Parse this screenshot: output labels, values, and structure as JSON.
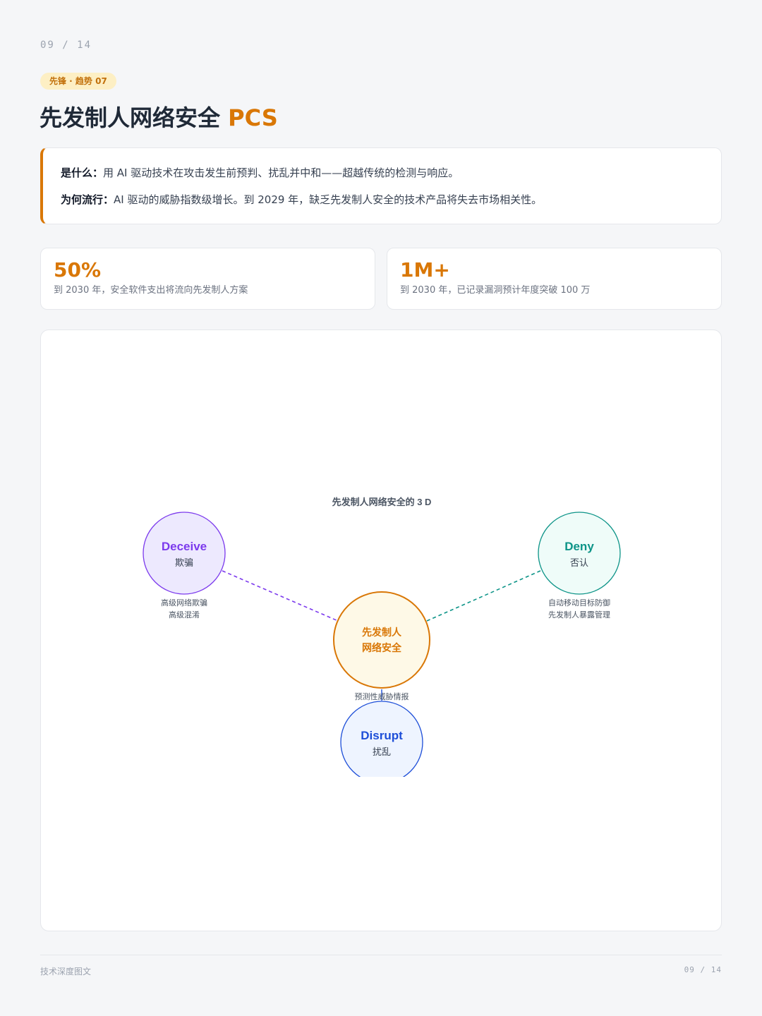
{
  "page": {
    "number": "09 / 14",
    "footer_left": "技术深度图文"
  },
  "header": {
    "tag": "先锋 · 趋势 07",
    "title_main": "先发制人网络安全",
    "title_accent": "PCS"
  },
  "intro": {
    "what_label": "是什么：",
    "what_text": "用 AI 驱动技术在攻击发生前预判、扰乱并中和——超越传统的检测与响应。",
    "why_label": "为何流行：",
    "why_text": "AI 驱动的威胁指数级增长。到 2029 年，缺乏先发制人安全的技术产品将失去市场相关性。"
  },
  "stats": [
    {
      "value": "50%",
      "label": "到 2030 年，安全软件支出将流向先发制人方案"
    },
    {
      "value": "1M+",
      "label": "到 2030 年，已记录漏洞预计年度突破 100 万"
    }
  ],
  "diagram": {
    "title": "先发制人网络安全的 3 D",
    "center": {
      "line1": "先发制人",
      "line2": "网络安全",
      "color": "#d97706",
      "fill": "#fef9e7"
    },
    "nodes": {
      "deceive": {
        "en": "Deceive",
        "zh": "欺骗",
        "notes": [
          "高级网络欺骗",
          "高级混淆"
        ],
        "color": "#7c3aed",
        "fill": "#ede9fe"
      },
      "deny": {
        "en": "Deny",
        "zh": "否认",
        "notes": [
          "自动移动目标防御",
          "先发制人暴露管理"
        ],
        "color": "#0d9488",
        "fill": "#effcf9"
      },
      "disrupt": {
        "en": "Disrupt",
        "zh": "扰乱",
        "notes": [
          "预测性威胁情报"
        ],
        "color": "#1d4ed8",
        "fill": "#eef4ff"
      }
    }
  }
}
